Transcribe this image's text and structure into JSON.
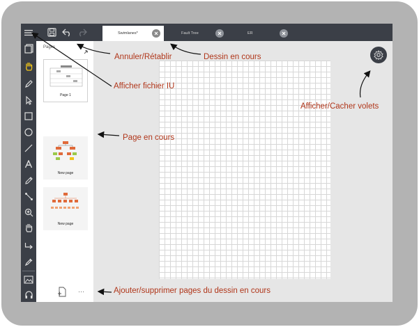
{
  "tabs": [
    {
      "label": "Swimlanes*",
      "active": true
    },
    {
      "label": "Fault Tree",
      "active": false
    },
    {
      "label": "ER",
      "active": false
    }
  ],
  "pages_panel": {
    "title": "Pages",
    "pages": [
      {
        "label": "Page 1",
        "active": true
      },
      {
        "label": "New page",
        "active": false
      },
      {
        "label": "New page",
        "active": false
      }
    ],
    "more_label": "···"
  },
  "annotations": {
    "undo_redo": "Annuler/Rétablir",
    "current_drawing": "Dessin en cours",
    "show_ui_file": "Afficher fichier IU",
    "toggle_panels": "Afficher/Cacher volets",
    "current_page": "Page en cours",
    "add_remove_pages": "Ajouter/supprimer pages du dessin en cours"
  },
  "colors": {
    "toolbar": "#3b3f47",
    "annotation": "#b0361a",
    "active_tool": "#f0c419"
  }
}
